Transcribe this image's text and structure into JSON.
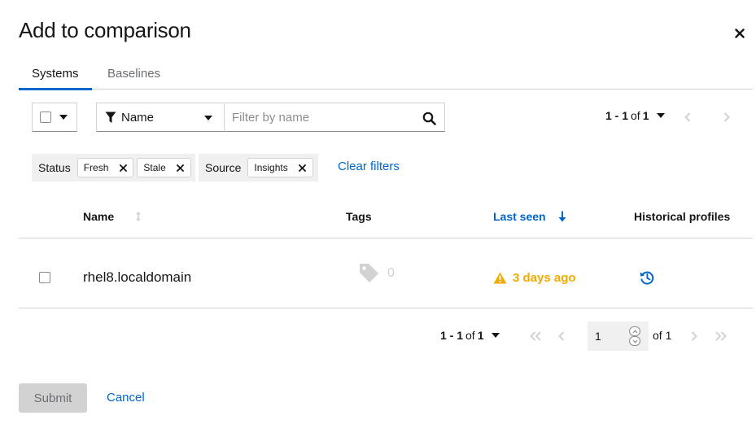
{
  "modal": {
    "title": "Add to comparison",
    "close_icon": "close-icon"
  },
  "tabs": [
    {
      "label": "Systems",
      "active": true
    },
    {
      "label": "Baselines",
      "active": false
    }
  ],
  "toolbar": {
    "filter_attribute": "Name",
    "filter_placeholder": "Filter by name",
    "pagination_range": "1 - 1",
    "pagination_of": "of",
    "pagination_total": "1"
  },
  "chips": {
    "status": {
      "category": "Status",
      "values": [
        "Fresh",
        "Stale"
      ]
    },
    "source": {
      "category": "Source",
      "values": [
        "Insights"
      ]
    },
    "clear_label": "Clear filters"
  },
  "table": {
    "columns": [
      "Name",
      "Tags",
      "Last seen",
      "Historical profiles"
    ],
    "sorted_column": "Last seen",
    "rows": [
      {
        "name": "rhel8.localdomain",
        "tags_count": "0",
        "last_seen": "3 days ago"
      }
    ]
  },
  "bottom_pagination": {
    "range": "1 - 1",
    "of": "of",
    "total": "1",
    "page_value": "1",
    "page_of": "of 1"
  },
  "footer": {
    "submit_label": "Submit",
    "cancel_label": "Cancel"
  },
  "colors": {
    "accent": "#0066cc",
    "warning": "#f0ab00",
    "border": "#d2d2d2"
  }
}
